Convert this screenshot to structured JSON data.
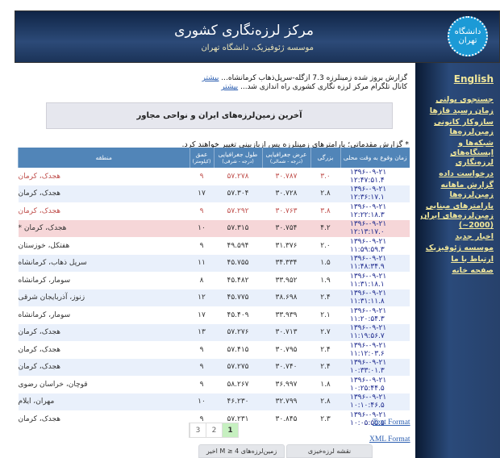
{
  "header": {
    "title": "مرکز لرزه‌نگاری کشوری",
    "subtitle": "موسسه ژئوفیزیک، دانشگاه تهران",
    "logo_text": "دانشگاه تهران"
  },
  "sidebar": {
    "english": "English",
    "items": [
      "جستجوی پولنی",
      "زمان رسید فازها",
      "سازوکار کانونی زمین‌لرزه‌ها",
      "شبکه‌ها و ایستگاه‌های لرزه‌نگاری",
      "درخواست داده",
      "گزارش ماهانه زمین‌لرزه‌ها",
      "پارامترهای مبنایی زمین‌لرزه‌های ایران (2000~)",
      "اخبار جدید",
      "موسسه ژئوفیزیک",
      "ارتباط با ما",
      "صفحه خانه"
    ]
  },
  "news": [
    {
      "text": "گزارش بروز شده زمینلرزه 7.3 ازگله-سرپل‌ذهاب کرمانشاه... ",
      "link": "بیشتر"
    },
    {
      "text": "کانال تلگرام مرکز لرزه نگاری کشوری راه اندازی شد... ",
      "link": "بیشتر"
    }
  ],
  "infobox": "آخرین زمین‌لرزه‌های ایران و نواحی مجاور",
  "note": "* گزارش مقدماتی؛ پارامترهای زمینلرزه پس ازبازبینی تغییر خواهند کرد.",
  "table": {
    "headers": {
      "time": "زمان وقوع به وقت محلی",
      "mag": "بزرگی",
      "lat": "عرض جغرافیایی",
      "lat_unit": "(درجه - شمالی)",
      "lon": "طول جغرافیایی",
      "lon_unit": "(درجه - شرقی)",
      "depth": "عمق",
      "depth_unit": "(کیلومتر)",
      "region": "منطقه"
    },
    "rows": [
      {
        "time": "۱۳۹۶-۰۹-۲۱ ۱۲:۴۷:۵۱.۴",
        "mag": "۳.۰",
        "lat": "۳۰.۷۸۷",
        "lon": "۵۷.۲۷۸",
        "depth": "۹",
        "region": "هجدک، کرمان",
        "style": "red"
      },
      {
        "time": "۱۳۹۶-۰۹-۲۱ ۱۲:۳۶:۱۷.۱",
        "mag": "۲.۸",
        "lat": "۳۰.۷۲۸",
        "lon": "۵۷.۳۰۴",
        "depth": "۱۷",
        "region": "هجدک، کرمان",
        "style": "alt"
      },
      {
        "time": "۱۳۹۶-۰۹-۲۱ ۱۲:۲۲:۱۸.۳",
        "mag": "۳.۸",
        "lat": "۳۰.۷۶۳",
        "lon": "۵۷.۲۹۲",
        "depth": "۹",
        "region": "هجدک، کرمان",
        "style": "red"
      },
      {
        "time": "۱۳۹۶-۰۹-۲۱ ۱۲:۱۳:۱۷.۰",
        "mag": "۴.۲",
        "lat": "۳۰.۷۵۴",
        "lon": "۵۷.۳۱۵",
        "depth": "۱۰",
        "region": "هجدک، کرمان *",
        "style": "big"
      },
      {
        "time": "۱۳۹۶-۰۹-۲۱ ۱۱:۵۹:۵۹.۳",
        "mag": "۲.۰",
        "lat": "۳۱.۳۷۶",
        "lon": "۴۹.۵۹۴",
        "depth": "۹",
        "region": "هفتکل، خوزستان",
        "style": ""
      },
      {
        "time": "۱۳۹۶-۰۹-۲۱ ۱۱:۴۸:۳۴.۹",
        "mag": "۱.۵",
        "lat": "۳۴.۳۳۴",
        "lon": "۴۵.۷۵۵",
        "depth": "۱۱",
        "region": "سرپل ذهاب، کرمانشاه",
        "style": "alt"
      },
      {
        "time": "۱۳۹۶-۰۹-۲۱ ۱۱:۳۱:۱۸.۱",
        "mag": "۱.۹",
        "lat": "۳۳.۹۵۲",
        "lon": "۴۵.۴۸۲",
        "depth": "۸",
        "region": "سومار، کرمانشاه",
        "style": ""
      },
      {
        "time": "۱۳۹۶-۰۹-۲۱ ۱۱:۳۱:۱۱.۸",
        "mag": "۲.۴",
        "lat": "۳۸.۶۹۸",
        "lon": "۴۵.۷۷۵",
        "depth": "۱۲",
        "region": "زنوز، آذربایجان شرقی",
        "style": "alt"
      },
      {
        "time": "۱۳۹۶-۰۹-۲۱ ۱۱:۲۰:۵۴.۳",
        "mag": "۲.۱",
        "lat": "۳۳.۹۳۹",
        "lon": "۴۵.۴۰۹",
        "depth": "۱۷",
        "region": "سومار، کرمانشاه",
        "style": ""
      },
      {
        "time": "۱۳۹۶-۰۹-۲۱ ۱۱:۱۹:۵۶.۷",
        "mag": "۲.۷",
        "lat": "۳۰.۷۱۳",
        "lon": "۵۷.۲۷۶",
        "depth": "۱۳",
        "region": "هجدک، کرمان",
        "style": "alt"
      },
      {
        "time": "۱۳۹۶-۰۹-۲۱ ۱۱:۱۲:۰۳.۶",
        "mag": "۲.۴",
        "lat": "۳۰.۷۹۵",
        "lon": "۵۷.۴۱۵",
        "depth": "۹",
        "region": "هجدک، کرمان",
        "style": ""
      },
      {
        "time": "۱۳۹۶-۰۹-۲۱ ۱۰:۳۳:۰۱.۳",
        "mag": "۲.۴",
        "lat": "۳۰.۷۴۰",
        "lon": "۵۷.۲۷۵",
        "depth": "۹",
        "region": "هجدک، کرمان",
        "style": "alt"
      },
      {
        "time": "۱۳۹۶-۰۹-۲۱ ۱۰:۲۵:۴۴.۵",
        "mag": "۱.۸",
        "lat": "۳۶.۹۹۷",
        "lon": "۵۸.۲۶۷",
        "depth": "۹",
        "region": "قوچان، خراسان رضوی",
        "style": ""
      },
      {
        "time": "۱۳۹۶-۰۹-۲۱ ۱۰:۱۰:۴۶.۵",
        "mag": "۲.۸",
        "lat": "۳۲.۷۹۹",
        "lon": "۴۶.۲۳۰",
        "depth": "۱۰",
        "region": "مهران، ایلام",
        "style": "alt"
      },
      {
        "time": "۱۳۹۶-۰۹-۲۱ ۱۰:۰۵:۵۵.۵",
        "mag": "۲.۳",
        "lat": "۳۰.۸۴۵",
        "lon": "۵۷.۲۳۱",
        "depth": "۹",
        "region": "هجدک، کرمان",
        "style": ""
      }
    ]
  },
  "pagination": {
    "pages": [
      "3",
      "2",
      "1"
    ],
    "current": "1"
  },
  "formats": {
    "text": "Text Format",
    "xml": "XML Format"
  },
  "buttons": {
    "map": "نقشه لرزه‌خیزی",
    "recent": "زمین‌لرزه‌های M ≥ 4 اخیر"
  },
  "colors": {
    "header": "#1b3358",
    "table_header": "#5185b8",
    "highlight_row": "#f6d6d8",
    "alt_row": "#e9f0fb",
    "link": "#f1e79a"
  }
}
